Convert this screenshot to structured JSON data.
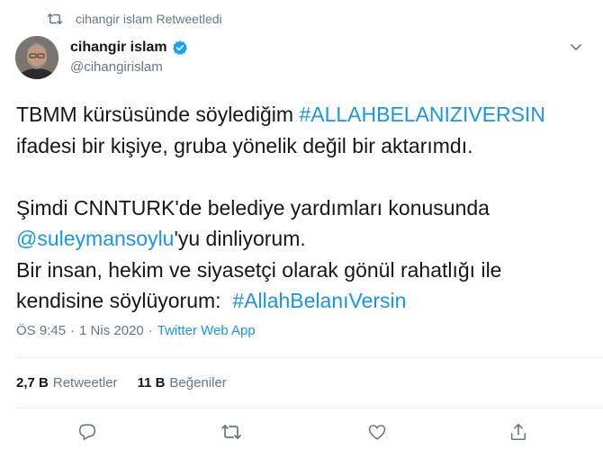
{
  "retweet_context": {
    "label": "cihangir islam Retweetledi",
    "icon": "retweet-icon"
  },
  "author": {
    "name": "cihangir islam",
    "handle": "@cihangirislam",
    "verified": true,
    "avatar": "avatar-photo"
  },
  "tweet": {
    "line1_prefix": "TBMM kürsüsünde söylediğim ",
    "hashtag1": "#ALLAHBELANIZIVERSIN",
    "line2": " ifadesi bir kişiye, gruba yönelik değil bir aktarımdı.",
    "line3": "Şimdi CNNTURK'de belediye yardımları konusunda",
    "mention": "@suleymansoylu",
    "line4_suffix": "'yu dinliyorum.",
    "line5": "Bir insan, hekim ve siyasetçi olarak gönül rahatlığı ile",
    "line6_prefix": "kendisine söylüyorum:  ",
    "hashtag2": "#AllahBelanıVersin"
  },
  "meta": {
    "time": "ÖS 9:45",
    "separator1": "·",
    "date": "1 Nis 2020",
    "separator2": "·",
    "source": "Twitter Web App"
  },
  "stats": {
    "retweets_count": "2,7 B",
    "retweets_label": "Retweetler",
    "likes_count": "11 B",
    "likes_label": "Beğeniler"
  },
  "actions": {
    "reply": "reply-icon",
    "retweet": "retweet-icon",
    "like": "heart-icon",
    "share": "share-icon"
  },
  "colors": {
    "link": "#1b95e0",
    "secondary_text": "#657786",
    "primary_text": "#14171a",
    "divider": "#e6ecf0",
    "verified": "#1da1f2"
  }
}
